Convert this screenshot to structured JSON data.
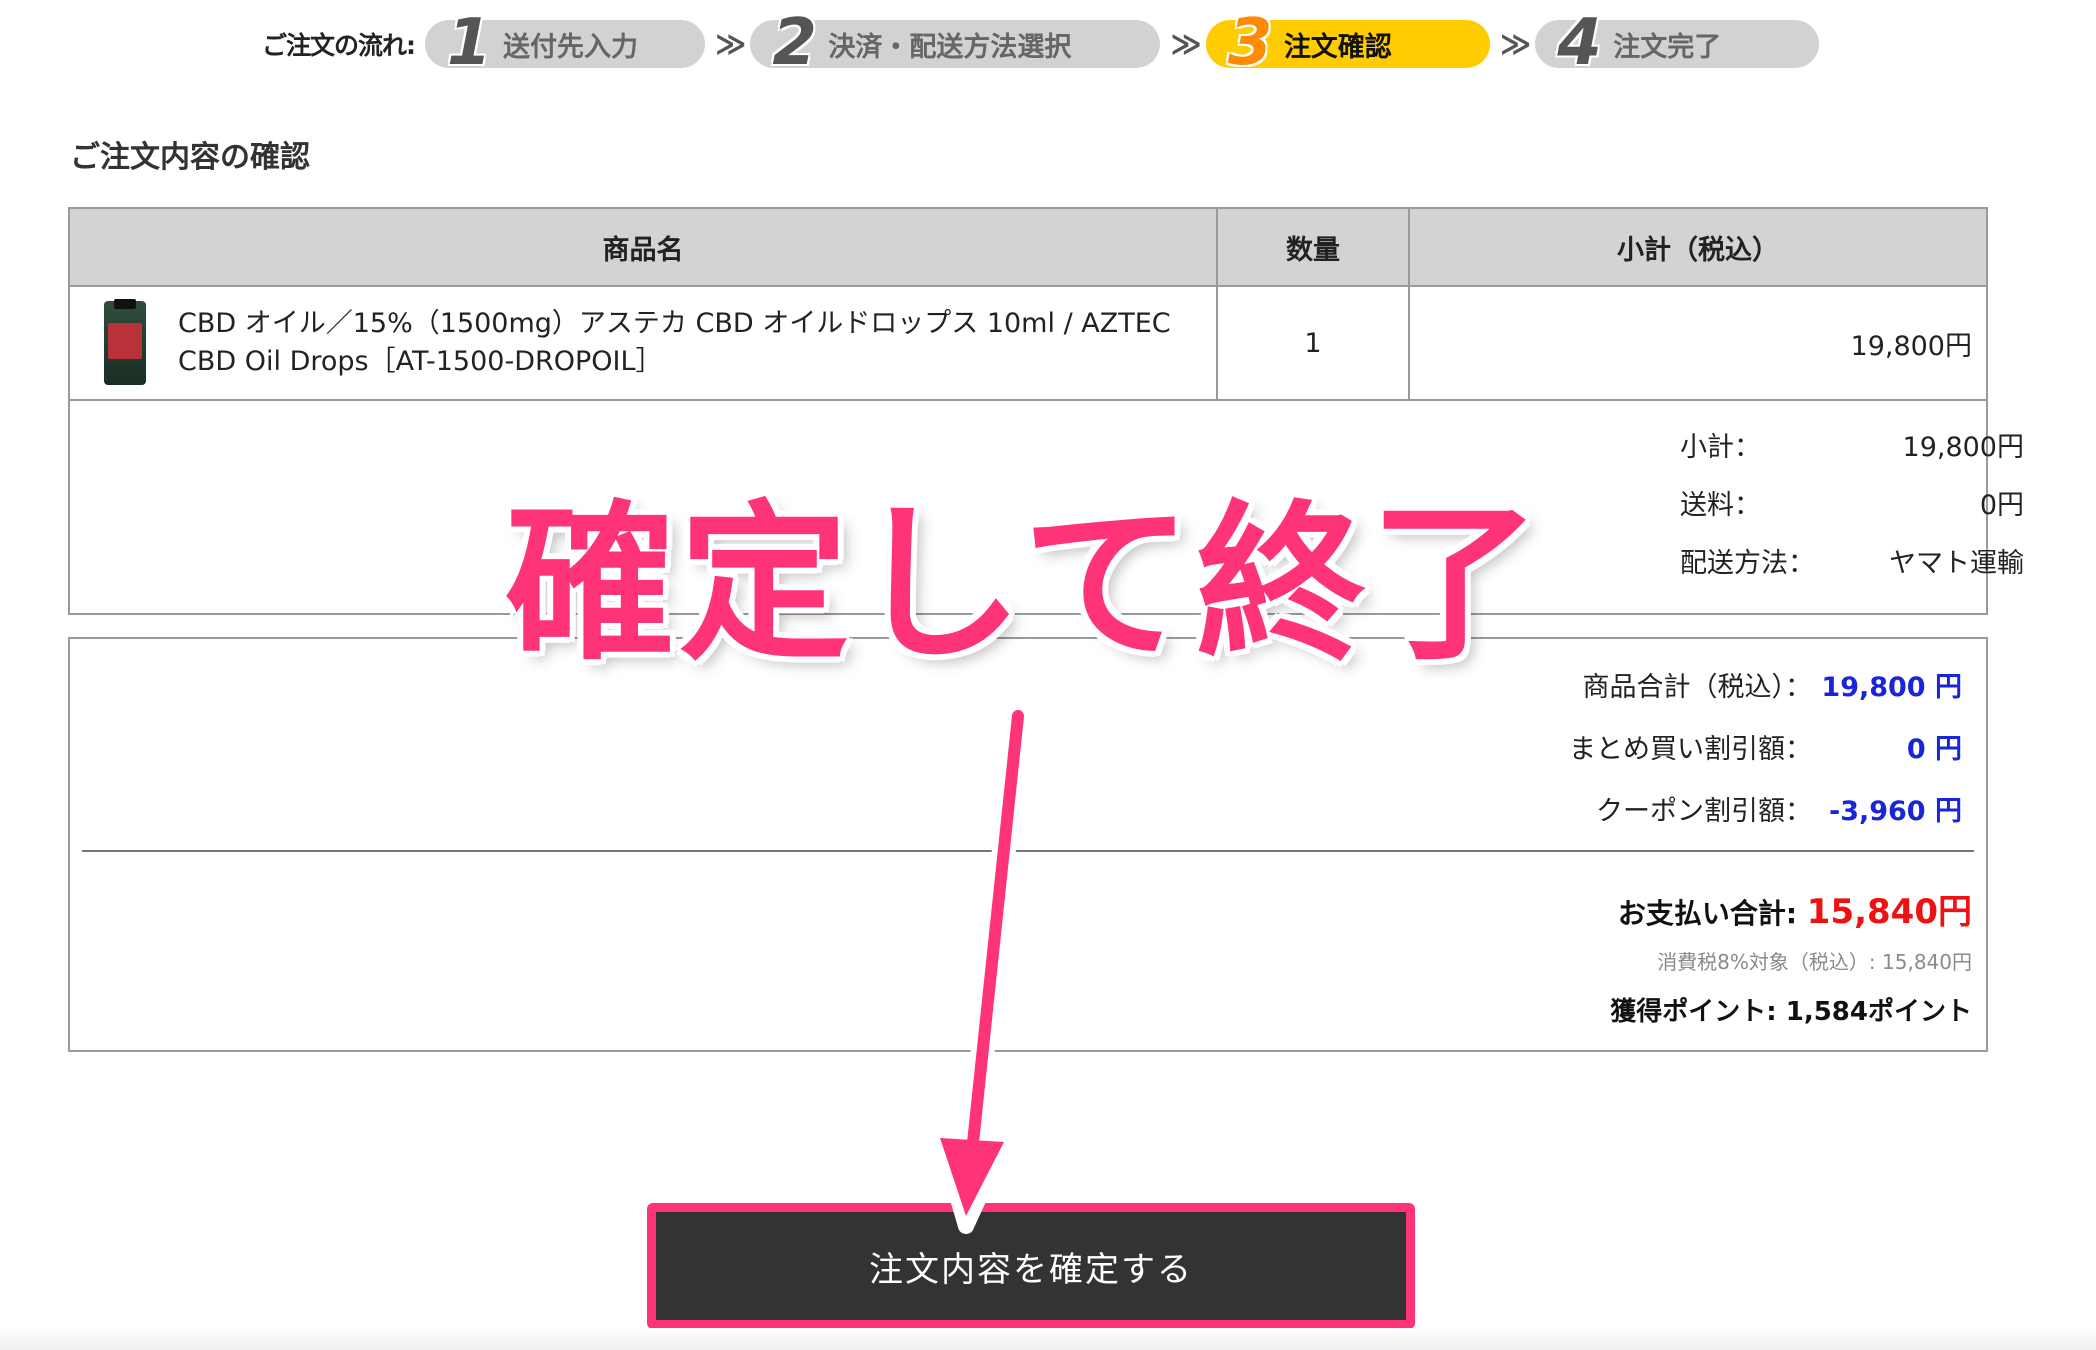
{
  "flow": {
    "label": "ご注文の流れ:",
    "separator": "≫",
    "steps": [
      {
        "num": "1",
        "label": "送付先入力",
        "active": false
      },
      {
        "num": "2",
        "label": "決済・配送方法選択",
        "active": false
      },
      {
        "num": "3",
        "label": "注文確認",
        "active": true
      },
      {
        "num": "4",
        "label": "注文完了",
        "active": false
      }
    ]
  },
  "section_title": "ご注文内容の確認",
  "table": {
    "headers": [
      "商品名",
      "数量",
      "小計（税込）"
    ],
    "rows": [
      {
        "name": "CBD オイル／15%（1500mg）アステカ CBD オイルドロップス 10ml / AZTEC CBD Oil Drops［AT-1500-DROPOIL］",
        "qty": "1",
        "subtotal": "19,800円"
      }
    ],
    "summary": [
      {
        "key": "小計：",
        "value": "19,800円"
      },
      {
        "key": "送料：",
        "value": "0円"
      },
      {
        "key": "配送方法：",
        "value": "ヤマト運輸"
      }
    ]
  },
  "totals": {
    "items_total": {
      "key": "商品合計（税込）：",
      "value": "19,800 円"
    },
    "bulk_discount": {
      "key": "まとめ買い割引額：",
      "value": "0 円"
    },
    "coupon_discount": {
      "key": "クーポン割引額：",
      "value": "-3,960 円"
    },
    "payment_total": {
      "key": "お支払い合計:",
      "value": "15,840円"
    },
    "tax_note": "消費税8%対象（税込）: 15,840円",
    "points": "獲得ポイント: 1,584ポイント"
  },
  "confirm_button": "注文内容を確定する",
  "annotation": "確定して終了",
  "colors": {
    "active_step": "#ffcc00",
    "accent": "#ff3377",
    "total_red": "#ee1111",
    "blue_value": "#1a24d8",
    "button_bg": "#333333"
  }
}
